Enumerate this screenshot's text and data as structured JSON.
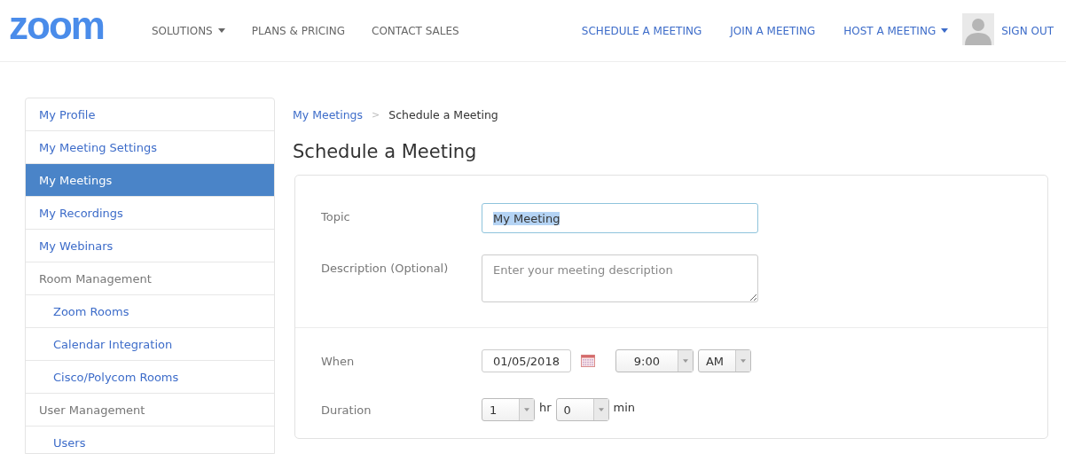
{
  "header": {
    "logo": "zoom",
    "nav_left": [
      {
        "label": "SOLUTIONS",
        "dropdown": true
      },
      {
        "label": "PLANS & PRICING",
        "dropdown": false
      },
      {
        "label": "CONTACT SALES",
        "dropdown": false
      }
    ],
    "nav_right": [
      {
        "label": "SCHEDULE A MEETING",
        "dropdown": false
      },
      {
        "label": "JOIN A MEETING",
        "dropdown": false
      },
      {
        "label": "HOST A MEETING",
        "dropdown": true
      }
    ],
    "sign_out": "SIGN OUT"
  },
  "sidebar": {
    "items": [
      {
        "label": "My Profile",
        "kind": "link",
        "selected": false
      },
      {
        "label": "My Meeting Settings",
        "kind": "link",
        "selected": false
      },
      {
        "label": "My Meetings",
        "kind": "link",
        "selected": true
      },
      {
        "label": "My Recordings",
        "kind": "link",
        "selected": false
      },
      {
        "label": "My Webinars",
        "kind": "link",
        "selected": false
      },
      {
        "label": "Room Management",
        "kind": "section",
        "selected": false
      },
      {
        "label": "Zoom Rooms",
        "kind": "subitem",
        "selected": false
      },
      {
        "label": "Calendar Integration",
        "kind": "subitem",
        "selected": false
      },
      {
        "label": "Cisco/Polycom Rooms",
        "kind": "subitem",
        "selected": false
      },
      {
        "label": "User Management",
        "kind": "section",
        "selected": false
      },
      {
        "label": "Users",
        "kind": "subitem",
        "selected": false
      }
    ]
  },
  "breadcrumb": [
    {
      "label": "My Meetings",
      "kind": "link"
    },
    {
      "label": ">",
      "kind": "separator"
    },
    {
      "label": "Schedule a Meeting",
      "kind": "current"
    }
  ],
  "title": "Schedule a Meeting",
  "form": {
    "topic": {
      "label": "Topic",
      "value": "My Meeting",
      "text_selected": true
    },
    "description": {
      "label": "Description (Optional)",
      "placeholder": "Enter your meeting description"
    },
    "when": {
      "label": "When",
      "date": "01/05/2018",
      "time": "9:00",
      "ampm": "AM"
    },
    "duration": {
      "label": "Duration",
      "hours": "1",
      "hr_unit": "hr",
      "minutes": "0",
      "min_unit": "min"
    }
  }
}
